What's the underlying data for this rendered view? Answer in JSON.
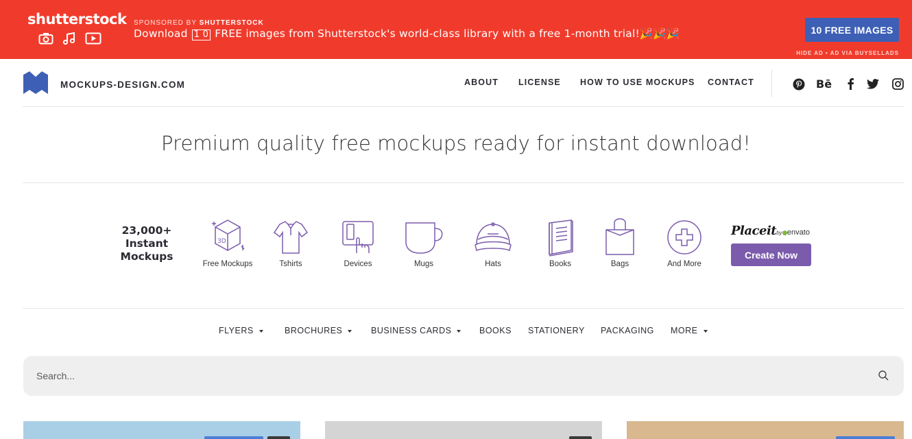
{
  "ad": {
    "brand": "shutterstock",
    "sponsored_prefix": "SPONSORED BY",
    "sponsored_brand": "SHUTTERSTOCK",
    "text_before": "Download",
    "boxed_number": "1 0",
    "text_after": "FREE images from Shutterstock's world-class library with a free 1-month trial!",
    "emojis": "🎉🎉🎉",
    "cta": "10 FREE IMAGES",
    "hide_label": "HIDE AD • AD VIA BUYSELLADS",
    "media_icons": [
      "camera-icon",
      "music-note-icon",
      "play-icon"
    ],
    "bg_color": "#f03b2c",
    "cta_color": "#3d5fb5"
  },
  "header": {
    "site_name": "MOCKUPS-DESIGN.COM",
    "logo_color": "#3d5fb5",
    "nav": [
      "ABOUT",
      "LICENSE",
      "HOW TO USE MOCKUPS",
      "CONTACT"
    ],
    "social": [
      {
        "name": "pinterest-icon",
        "glyph": ""
      },
      {
        "name": "behance-icon",
        "glyph": "Bē"
      },
      {
        "name": "facebook-icon",
        "glyph": "f"
      },
      {
        "name": "twitter-icon",
        "glyph": ""
      },
      {
        "name": "instagram-icon",
        "glyph": ""
      }
    ]
  },
  "tagline": "Premium quality free mockups ready for instant download!",
  "categories": {
    "count_line1": "23,000+",
    "count_line2": "Instant",
    "count_line3": "Mockups",
    "icon_color": "#7b5bac",
    "items": [
      {
        "label": "Free Mockups",
        "icon": "3d-box-icon"
      },
      {
        "label": "Tshirts",
        "icon": "tshirt-icon"
      },
      {
        "label": "Devices",
        "icon": "devices-icon"
      },
      {
        "label": "Mugs",
        "icon": "mug-icon"
      },
      {
        "label": "Hats",
        "icon": "hat-icon"
      },
      {
        "label": "Books",
        "icon": "book-icon"
      },
      {
        "label": "Bags",
        "icon": "bag-icon"
      },
      {
        "label": "And More",
        "icon": "plus-circle-icon"
      }
    ]
  },
  "placeit": {
    "brand": "Placeit",
    "by": "by",
    "partner": "envato",
    "cta": "Create Now",
    "cta_color": "#7b5bac"
  },
  "subnav": [
    {
      "label": "FLYERS",
      "dropdown": true
    },
    {
      "label": "BROCHURES",
      "dropdown": true
    },
    {
      "label": "BUSINESS CARDS",
      "dropdown": true
    },
    {
      "label": "BOOKS",
      "dropdown": false
    },
    {
      "label": "STATIONERY",
      "dropdown": false
    },
    {
      "label": "PACKAGING",
      "dropdown": false
    },
    {
      "label": "MORE",
      "dropdown": true
    }
  ],
  "search": {
    "placeholder": "Search..."
  },
  "cards": [
    {
      "color": "#a9cfe6"
    },
    {
      "color": "#d4d4d4"
    },
    {
      "color": "#d9b88f"
    }
  ]
}
